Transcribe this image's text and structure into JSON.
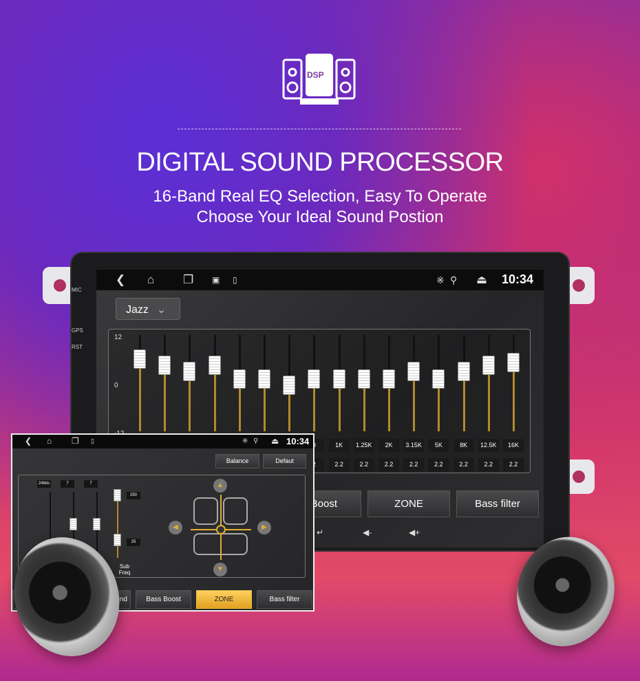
{
  "header": {
    "icon_label": "DSP",
    "title": "DIGITAL SOUND PROCESSOR",
    "subtitle_1": "16-Band Real EQ Selection, Easy To Operate",
    "subtitle_2": "Choose Your Ideal Sound Postion"
  },
  "device": {
    "side_labels": {
      "mic": "MIC",
      "gps": "GPS",
      "rst": "RST"
    }
  },
  "main_screen": {
    "status": {
      "time": "10:34",
      "icons": [
        "back-icon",
        "home-icon",
        "recent-apps-icon",
        "image-icon",
        "sd-card-icon",
        "bluetooth-icon",
        "location-icon",
        "eject-icon"
      ]
    },
    "preset": "Jazz",
    "eq": {
      "y_ticks": [
        "12",
        "0",
        "-12"
      ],
      "ylim": [
        -12,
        12
      ],
      "bands_db": [
        6,
        4.5,
        3,
        4.5,
        1,
        1,
        -0.5,
        1,
        1,
        1,
        1,
        3,
        1,
        3,
        4.5,
        5.2
      ],
      "visible_freq_labels": [
        "0",
        "1K",
        "1.25K",
        "2K",
        "3.15K",
        "5K",
        "8K",
        "12.5K",
        "16K"
      ],
      "visible_q_values": [
        "2",
        "2.2",
        "2.2",
        "2.2",
        "2.2",
        "2.2",
        "2.2",
        "2.2",
        "2.2"
      ]
    },
    "buttons": [
      "s Boost",
      "ZONE",
      "Bass filter"
    ],
    "bottom_icons": [
      "return-icon",
      "volume-down-icon",
      "volume-up-icon"
    ]
  },
  "inset_screen": {
    "time": "10:34",
    "balance_label": "Balance",
    "default_label": "Defaut",
    "slider_tags": [
      "24bits",
      "7",
      "7"
    ],
    "sub_freq_high": "250",
    "sub_freq_low": "25",
    "sub_freq_label": "Sub Freq",
    "buttons": [
      "und",
      "Bass Boost",
      "ZONE",
      "Bass filter"
    ],
    "active_button": "ZONE",
    "accent": "#f0b830"
  }
}
